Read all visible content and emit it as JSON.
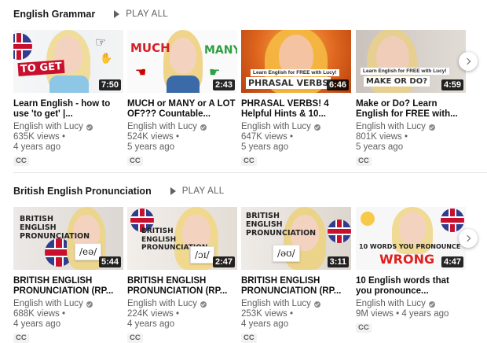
{
  "shelves": [
    {
      "title": "English Grammar",
      "play_all": "PLAY ALL",
      "videos": [
        {
          "title": "Learn English - how to use 'to get' |...",
          "channel": "English with Lucy",
          "views": "635K views •",
          "age": "4 years ago",
          "duration": "7:50",
          "badge": "CC",
          "thumb_text": "TO GET"
        },
        {
          "title": "MUCH or MANY or A LOT OF??? Countable...",
          "channel": "English with Lucy",
          "views": "524K views •",
          "age": "5 years ago",
          "duration": "2:43",
          "badge": "CC",
          "thumb_text_1": "MUCH",
          "thumb_text_2": "MANY"
        },
        {
          "title": "PHRASAL VERBS! 4 Helpful Hints & 10...",
          "channel": "English with Lucy",
          "views": "647K views •",
          "age": "5 years ago",
          "duration": "6:46",
          "badge": "CC",
          "thumb_ribbon": "Learn English for FREE with Lucy!",
          "thumb_text": "PHRASAL VERBS"
        },
        {
          "title": "Make or Do? Learn English for FREE with...",
          "channel": "English with Lucy",
          "views": "801K views •",
          "age": "5 years ago",
          "duration": "4:59",
          "badge": "CC",
          "thumb_ribbon": "Learn English for FREE with Lucy!",
          "thumb_text": "MAKE OR DO?"
        }
      ]
    },
    {
      "title": "British English Pronunciation",
      "play_all": "PLAY ALL",
      "videos": [
        {
          "title": "BRITISH ENGLISH PRONUNCIATION (RP...",
          "channel": "English with Lucy",
          "views": "688K views •",
          "age": "4 years ago",
          "duration": "5:44",
          "badge": "CC",
          "thumb_text": "BRITISH ENGLISH PRONUNCIATION",
          "thumb_symbol": "/eə/"
        },
        {
          "title": "BRITISH ENGLISH PRONUNCIATION (RP...",
          "channel": "English with Lucy",
          "views": "224K views •",
          "age": "4 years ago",
          "duration": "2:47",
          "badge": "CC",
          "thumb_text": "BRITISH ENGLISH PRONUNCIATION",
          "thumb_symbol": "/ɔɪ/"
        },
        {
          "title": "BRITISH ENGLISH PRONUNCIATION (RP...",
          "channel": "English with Lucy",
          "views": "253K views •",
          "age": "4 years ago",
          "duration": "3:11",
          "badge": "CC",
          "thumb_text": "BRITISH ENGLISH PRONUNCIATION",
          "thumb_symbol": "/əʊ/"
        },
        {
          "title": "10 English words that you pronounce...",
          "channel": "English with Lucy",
          "views": "9M views • 4 years ago",
          "age": "",
          "duration": "4:47",
          "badge": "CC",
          "thumb_text_1": "10 WORDS YOU PRONOUNCE",
          "thumb_text_2": "WRONG"
        }
      ]
    }
  ],
  "icons": {
    "next": "chevron-right-icon",
    "play": "play-icon",
    "verified": "verified-check-icon"
  },
  "colors": {
    "meta_text": "#606060",
    "title_text": "#0f0f0f",
    "divider": "#e5e5e5"
  }
}
